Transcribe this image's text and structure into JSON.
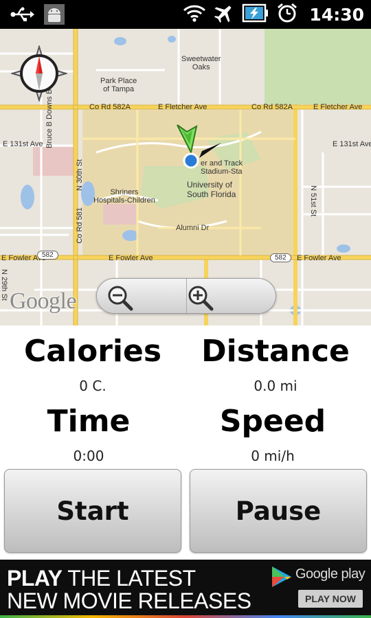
{
  "status_bar": {
    "time": "14:30",
    "icons": [
      "usb-icon",
      "android-debug-icon",
      "wifi-icon",
      "airplane-mode-icon",
      "battery-charging-icon",
      "alarm-icon"
    ]
  },
  "map": {
    "labels": {
      "sweetwater": "Sweetwater\nOaks",
      "park_place": "Park Place\nof Tampa",
      "co_rd_582a_left": "Co Rd 582A",
      "e_fletcher_left": "E Fletcher Ave",
      "co_rd_582a_right": "Co Rd 582A",
      "e_fletcher_right": "E Fletcher Ave",
      "e_131st_left": "E 131st Ave",
      "e_131st_right": "E 131st Ave",
      "bruce_b_downs": "Bruce B Downs Blvd",
      "n_30th": "N 30th St",
      "co_rd_581": "Co Rd 581",
      "track_stadium": "er and Track\nStadium-Sta",
      "usf": "University of\nSouth Florida",
      "shriners": "Shriners\nHospitals-Children",
      "alumni": "Alumni Dr",
      "n_51st": "N 51st St",
      "e_fowler_left": "E Fowler Ave",
      "e_fowler_right": "E Fowler Ave",
      "e_fowler_mid": "E Fowler Ave",
      "shield_582_left": "582",
      "shield_582_right": "582",
      "n_29th": "N 29th St"
    },
    "logo": "Google",
    "zoom_out_icon": "zoom-out-icon",
    "zoom_in_icon": "zoom-in-icon",
    "compass_icon": "compass-icon",
    "location_icon": "current-location-icon"
  },
  "stats": {
    "calories_label": "Calories",
    "calories_value": "0 C.",
    "distance_label": "Distance",
    "distance_value": "0.0 mi",
    "time_label": "Time",
    "time_value": "0:00",
    "speed_label": "Speed",
    "speed_value": "0 mi/h"
  },
  "buttons": {
    "start": "Start",
    "pause": "Pause"
  },
  "ad": {
    "line1_bold": "PLAY",
    "line1_rest": " THE LATEST",
    "line2": "NEW MOVIE RELEASES",
    "brand": "Google play",
    "cta": "PLAY NOW"
  },
  "colors": {
    "map_background": "#e9e5dc",
    "road_yellow": "#f7d35a",
    "park_green": "#c9dfb0",
    "water_blue": "#9ec1e8",
    "campus_tan": "#e8d9ad",
    "ad_background": "#0e0e0e"
  }
}
